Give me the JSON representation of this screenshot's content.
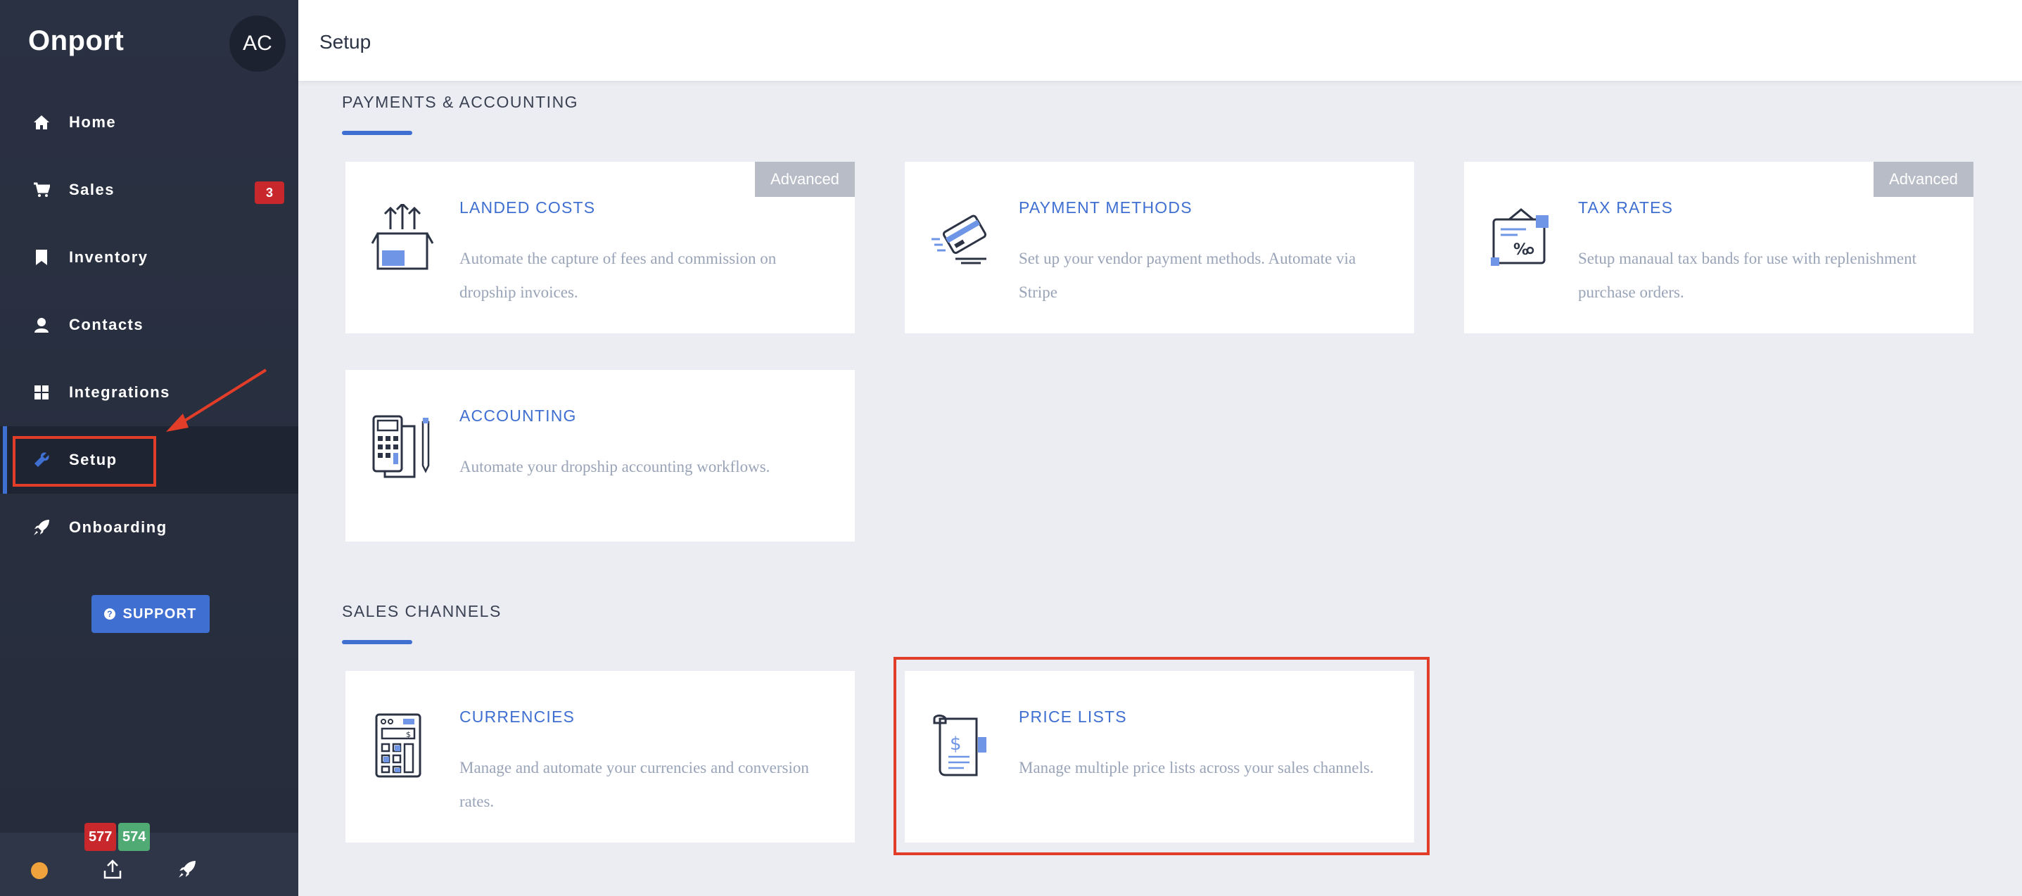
{
  "app": {
    "brand": "Onport",
    "avatar_initials": "AC"
  },
  "sidebar": {
    "items": [
      {
        "label": "Home",
        "icon": "home-icon"
      },
      {
        "label": "Sales",
        "icon": "cart-icon",
        "badge": "3"
      },
      {
        "label": "Inventory",
        "icon": "bookmark-icon"
      },
      {
        "label": "Contacts",
        "icon": "user-icon"
      },
      {
        "label": "Integrations",
        "icon": "grid-icon"
      },
      {
        "label": "Setup",
        "icon": "wrench-icon",
        "active": true
      },
      {
        "label": "Onboarding",
        "icon": "rocket-icon"
      }
    ],
    "support_label": "SUPPORT",
    "bottom": {
      "count_red": "577",
      "count_green": "574"
    }
  },
  "header": {
    "title": "Setup"
  },
  "sections": {
    "payments": {
      "title": "PAYMENTS & ACCOUNTING",
      "cards": [
        {
          "title": "LANDED COSTS",
          "desc": "Automate the capture of fees and commission on dropship invoices.",
          "badge": "Advanced",
          "icon": "box-arrows-icon"
        },
        {
          "title": "PAYMENT METHODS",
          "desc": "Set up your vendor payment methods. Automate via Stripe",
          "icon": "credit-card-icon"
        },
        {
          "title": "TAX RATES",
          "desc": "Setup manaual tax bands for use with replenishment purchase orders.",
          "badge": "Advanced",
          "icon": "tax-percent-icon"
        },
        {
          "title": "ACCOUNTING",
          "desc": "Automate your dropship accounting workflows.",
          "icon": "calculator-receipt-icon"
        }
      ]
    },
    "sales_channels": {
      "title": "SALES CHANNELS",
      "cards": [
        {
          "title": "CURRENCIES",
          "desc": "Manage and automate your currencies and conversion rates.",
          "icon": "calculator-icon"
        },
        {
          "title": "PRICE LISTS",
          "desc": "Manage multiple price lists across your sales channels.",
          "icon": "price-scroll-icon"
        }
      ]
    }
  },
  "colors": {
    "accent": "#3f6fd1",
    "sidebar": "#2a3142",
    "annotation": "#e23d28",
    "badge_red": "#c8282b",
    "badge_green": "#4faa74"
  }
}
